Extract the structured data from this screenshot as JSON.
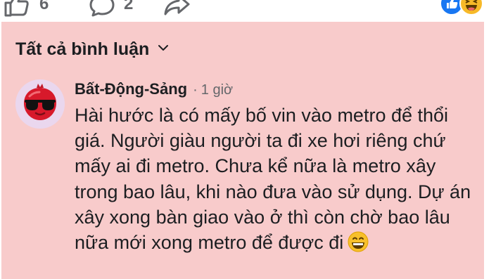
{
  "actions": {
    "like_icon": "thumbs-up-icon",
    "like_count": "6",
    "comment_icon": "comment-bubble-icon",
    "comment_count": "2",
    "share_icon": "share-arrow-icon"
  },
  "reactions": {
    "icons": [
      "like-reaction-icon",
      "haha-reaction-icon"
    ],
    "colors": {
      "like": "#1877f2",
      "haha": "#f7b928"
    }
  },
  "comments_section": {
    "sort_label": "Tất cả bình luận",
    "sort_icon": "chevron-down-icon",
    "background": "#f8cbcb"
  },
  "comment": {
    "author": "Bất-Động-Sảng",
    "separator": "·",
    "time": "1 giờ",
    "avatar_icon": "pomegranate-sunglasses-avatar",
    "text": "Hài hước là có mấy bố vin vào metro để thổi giá. Người giàu người ta đi xe hơi riêng chứ mấy ai đi metro. Chưa kể nữa là metro xây trong bao lâu, khi nào đưa vào sử dụng. Dự án xây xong bàn giao vào ở thì còn chờ bao lâu nữa mới xong metro để được đi",
    "trailing_emoji": "grinning-face-emoji"
  }
}
